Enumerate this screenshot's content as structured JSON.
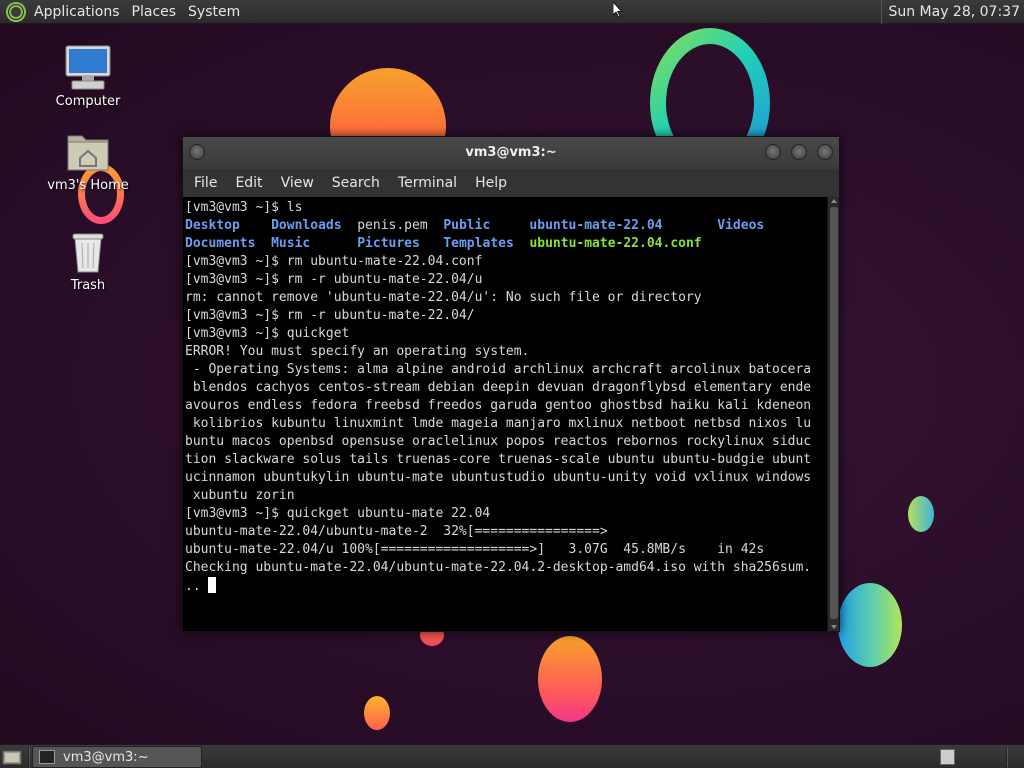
{
  "top_panel": {
    "menus": [
      "Applications",
      "Places",
      "System"
    ],
    "clock": "Sun May 28, 07:37"
  },
  "desktop_icons": [
    {
      "label": "Computer",
      "icon": "computer-icon"
    },
    {
      "label": "vm3's Home",
      "icon": "home-folder-icon"
    },
    {
      "label": "Trash",
      "icon": "trash-icon"
    }
  ],
  "terminal": {
    "title": "vm3@vm3:~",
    "menus": [
      "File",
      "Edit",
      "View",
      "Search",
      "Terminal",
      "Help"
    ],
    "lines": [
      {
        "segments": [
          {
            "text": "[vm3@vm3 ~]$ ls"
          }
        ]
      },
      {
        "segments": [
          {
            "text": "Desktop",
            "style": "blue"
          },
          {
            "text": "    "
          },
          {
            "text": "Downloads",
            "style": "blue"
          },
          {
            "text": "  penis.pem  "
          },
          {
            "text": "Public",
            "style": "blue"
          },
          {
            "text": "     "
          },
          {
            "text": "ubuntu-mate-22.04",
            "style": "blue"
          },
          {
            "text": "       "
          },
          {
            "text": "Videos",
            "style": "blue"
          }
        ]
      },
      {
        "segments": [
          {
            "text": "Documents",
            "style": "blue"
          },
          {
            "text": "  "
          },
          {
            "text": "Music",
            "style": "blue"
          },
          {
            "text": "      "
          },
          {
            "text": "Pictures",
            "style": "blue"
          },
          {
            "text": "   "
          },
          {
            "text": "Templates",
            "style": "blue"
          },
          {
            "text": "  "
          },
          {
            "text": "ubuntu-mate-22.04.conf",
            "style": "green"
          }
        ]
      },
      {
        "segments": [
          {
            "text": "[vm3@vm3 ~]$ rm ubuntu-mate-22.04.conf"
          }
        ]
      },
      {
        "segments": [
          {
            "text": "[vm3@vm3 ~]$ rm -r ubuntu-mate-22.04/u"
          }
        ]
      },
      {
        "segments": [
          {
            "text": "rm: cannot remove 'ubuntu-mate-22.04/u': No such file or directory"
          }
        ]
      },
      {
        "segments": [
          {
            "text": "[vm3@vm3 ~]$ rm -r ubuntu-mate-22.04/"
          }
        ]
      },
      {
        "segments": [
          {
            "text": "[vm3@vm3 ~]$ quickget"
          }
        ]
      },
      {
        "segments": [
          {
            "text": "ERROR! You must specify an operating system."
          }
        ]
      },
      {
        "segments": [
          {
            "text": " - Operating Systems: alma alpine android archlinux archcraft arcolinux batocera"
          }
        ]
      },
      {
        "segments": [
          {
            "text": " blendos cachyos centos-stream debian deepin devuan dragonflybsd elementary ende"
          }
        ]
      },
      {
        "segments": [
          {
            "text": "avouros endless fedora freebsd freedos garuda gentoo ghostbsd haiku kali kdeneon"
          }
        ]
      },
      {
        "segments": [
          {
            "text": " kolibrios kubuntu linuxmint lmde mageia manjaro mxlinux netboot netbsd nixos lu"
          }
        ]
      },
      {
        "segments": [
          {
            "text": "buntu macos openbsd opensuse oraclelinux popos reactos rebornos rockylinux siduc"
          }
        ]
      },
      {
        "segments": [
          {
            "text": "tion slackware solus tails truenas-core truenas-scale ubuntu ubuntu-budgie ubunt"
          }
        ]
      },
      {
        "segments": [
          {
            "text": "ucinnamon ubuntukylin ubuntu-mate ubuntustudio ubuntu-unity void vxlinux windows"
          }
        ]
      },
      {
        "segments": [
          {
            "text": " xubuntu zorin"
          }
        ]
      },
      {
        "segments": [
          {
            "text": "[vm3@vm3 ~]$ quickget ubuntu-mate 22.04"
          }
        ]
      },
      {
        "segments": [
          {
            "text": "ubuntu-mate-22.04/ubuntu-mate-2  32%[================>"
          }
        ]
      },
      {
        "segments": [
          {
            "text": "ubuntu-mate-22.04/u 100%[===================>]   3.07G  45.8MB/s    in 42s"
          }
        ]
      },
      {
        "segments": [
          {
            "text": "Checking ubuntu-mate-22.04/ubuntu-mate-22.04.2-desktop-amd64.iso with sha256sum."
          }
        ]
      },
      {
        "segments": [
          {
            "text": ".. "
          }
        ],
        "cursor": true
      }
    ]
  },
  "bottom_panel": {
    "task_label": "vm3@vm3:~"
  }
}
